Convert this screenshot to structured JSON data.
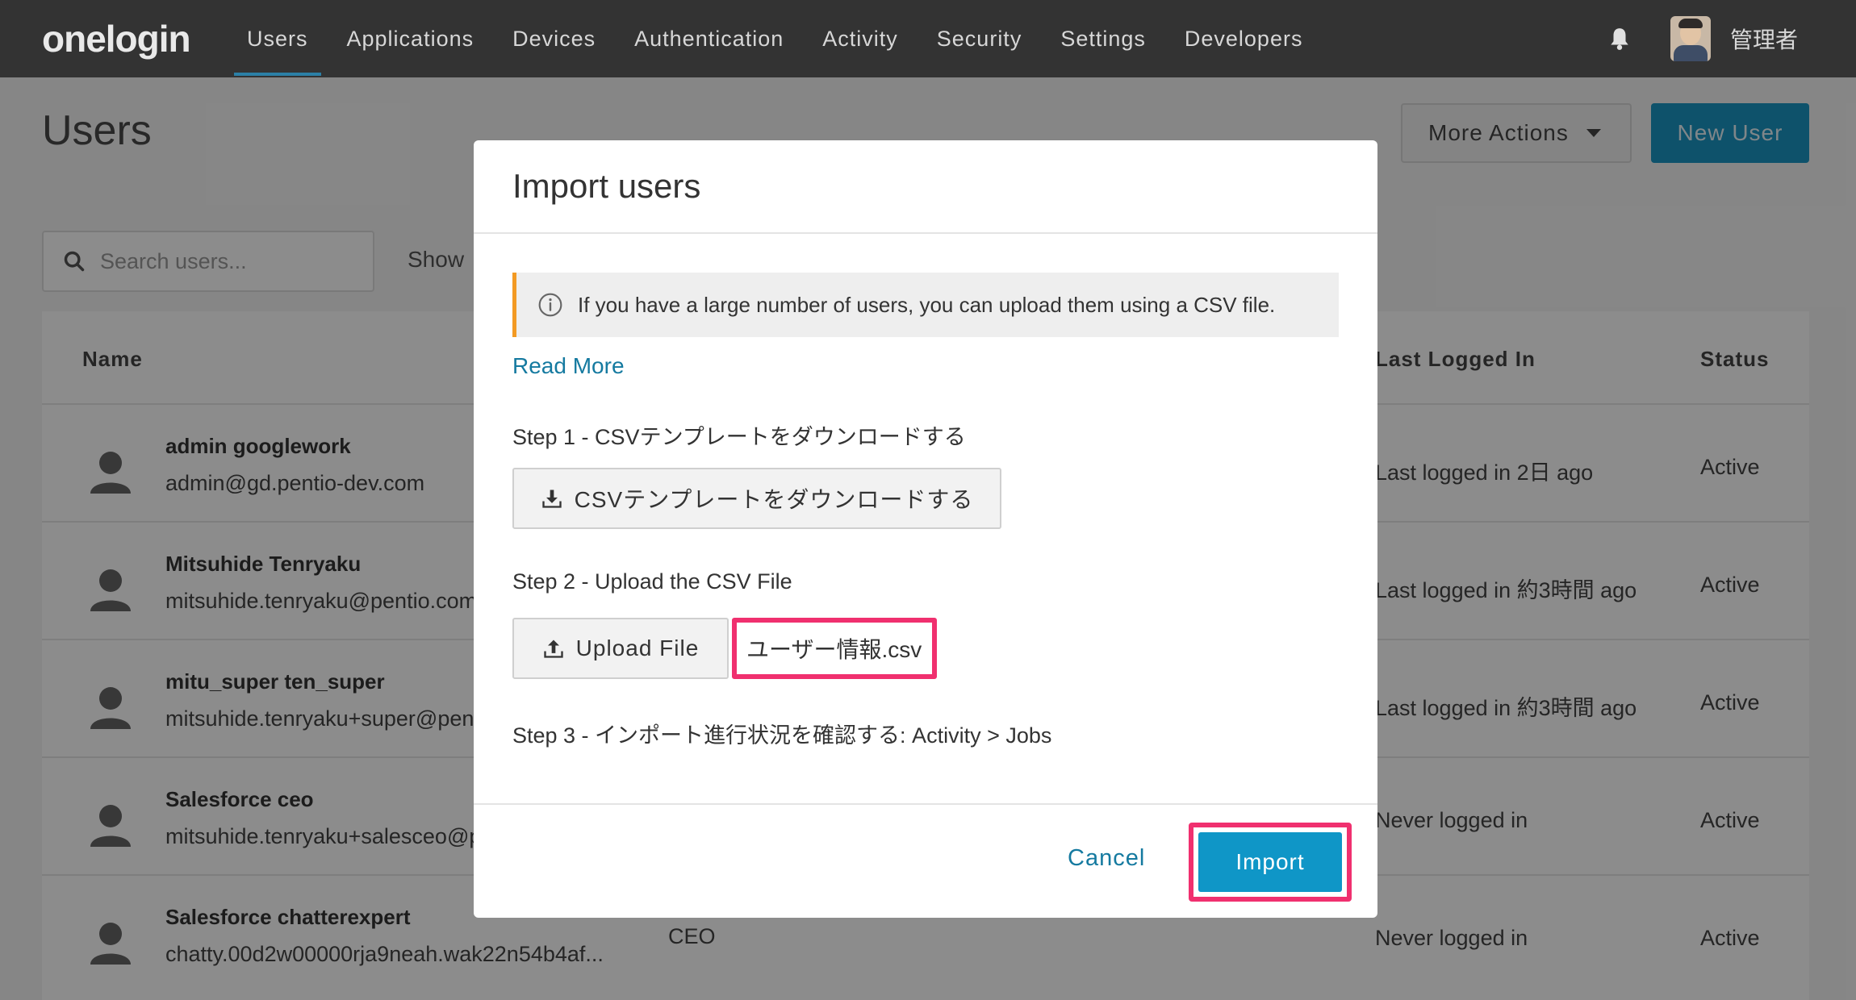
{
  "nav": {
    "logo": "onelogin",
    "items": [
      {
        "label": "Users",
        "active": true
      },
      {
        "label": "Applications",
        "active": false
      },
      {
        "label": "Devices",
        "active": false
      },
      {
        "label": "Authentication",
        "active": false
      },
      {
        "label": "Activity",
        "active": false
      },
      {
        "label": "Security",
        "active": false
      },
      {
        "label": "Settings",
        "active": false
      },
      {
        "label": "Developers",
        "active": false
      }
    ],
    "bell_icon": "bell-icon",
    "username": "管理者"
  },
  "page": {
    "title": "Users",
    "more_actions_label": "More Actions",
    "new_user_label": "New User",
    "search_placeholder": "Search users...",
    "show_label": "Show"
  },
  "table": {
    "headers": {
      "name": "Name",
      "last_logged_in": "Last Logged In",
      "status": "Status"
    },
    "rows": [
      {
        "name": "admin googlework",
        "email": "admin@gd.pentio-dev.com",
        "title": "",
        "last": "Last logged in 2日 ago",
        "status": "Active"
      },
      {
        "name": "Mitsuhide Tenryaku",
        "email": "mitsuhide.tenryaku@pentio.com",
        "title": "",
        "last": "Last logged in 約3時間 ago",
        "status": "Active"
      },
      {
        "name": "mitu_super ten_super",
        "email": "mitsuhide.tenryaku+super@pentio.com",
        "title": "",
        "last": "Last logged in 約3時間 ago",
        "status": "Active"
      },
      {
        "name": "Salesforce ceo",
        "email": "mitsuhide.tenryaku+salesceo@pentio.com",
        "title": "",
        "last": "Never logged in",
        "status": "Active"
      },
      {
        "name": "Salesforce chatterexpert",
        "email": "chatty.00d2w00000rja9neah.wak22n54b4af...",
        "title": "CEO",
        "last": "Never logged in",
        "status": "Active"
      }
    ]
  },
  "modal": {
    "title": "Import users",
    "info_text": "If you have a large number of users, you can upload them using a CSV file.",
    "read_more": "Read More",
    "step1": "Step 1 - CSVテンプレートをダウンロードする",
    "download_label": "CSVテンプレートをダウンロードする",
    "step2": "Step 2 - Upload the CSV File",
    "upload_label": "Upload File",
    "filename": "ユーザー情報.csv",
    "step3": "Step 3 - インポート進行状況を確認する: Activity > Jobs",
    "cancel_label": "Cancel",
    "import_label": "Import"
  },
  "colors": {
    "nav_bg": "#333333",
    "accent": "#0f96c7",
    "highlight": "#f0306f",
    "info_border": "#f39a23"
  }
}
